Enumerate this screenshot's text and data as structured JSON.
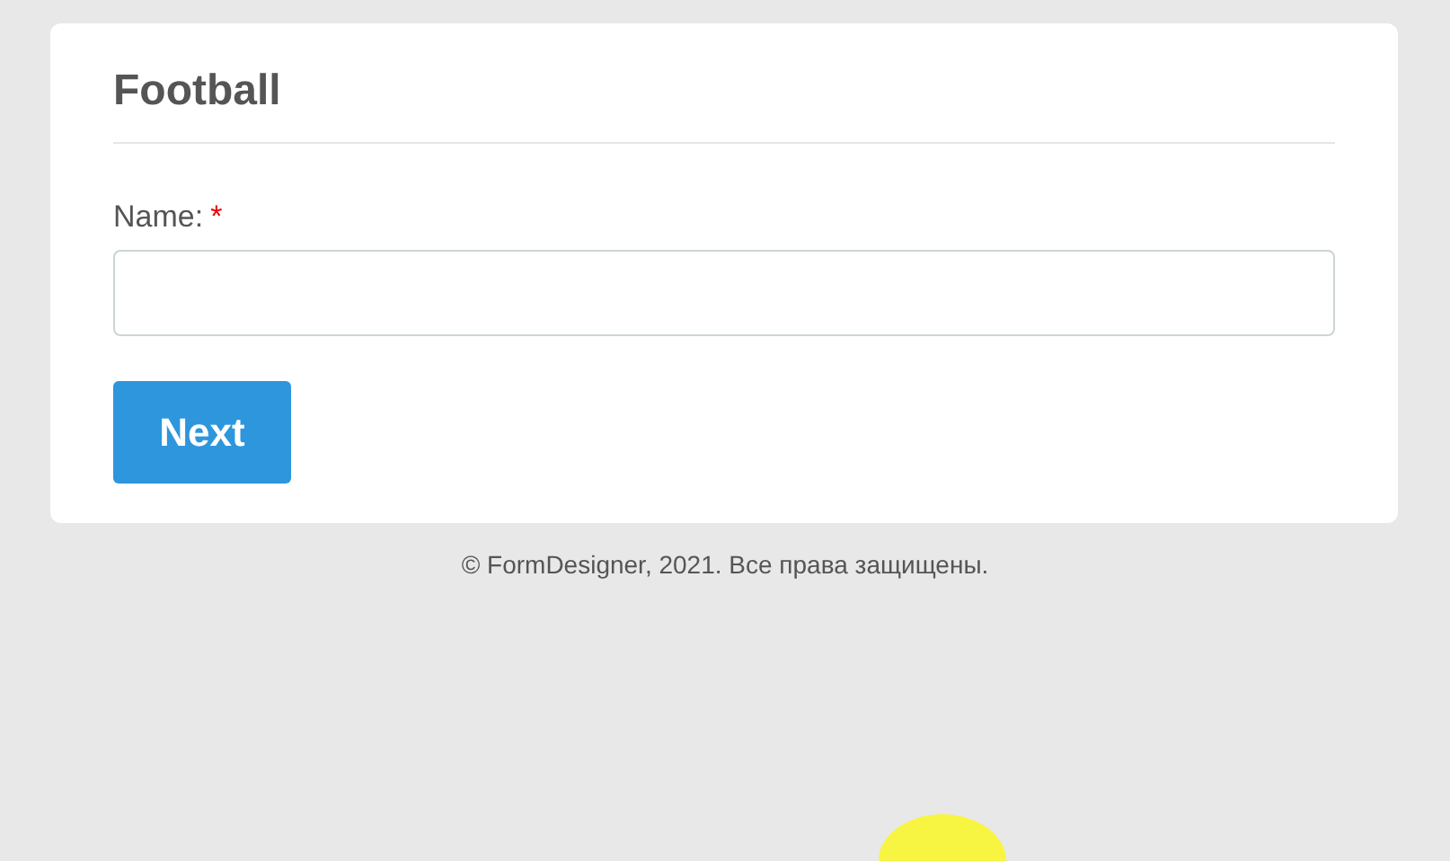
{
  "form": {
    "title": "Football",
    "fields": [
      {
        "label": "Name:",
        "required_mark": "*"
      }
    ],
    "buttons": [
      "Next"
    ]
  },
  "footer": "© FormDesigner, 2021. Все права защищены."
}
